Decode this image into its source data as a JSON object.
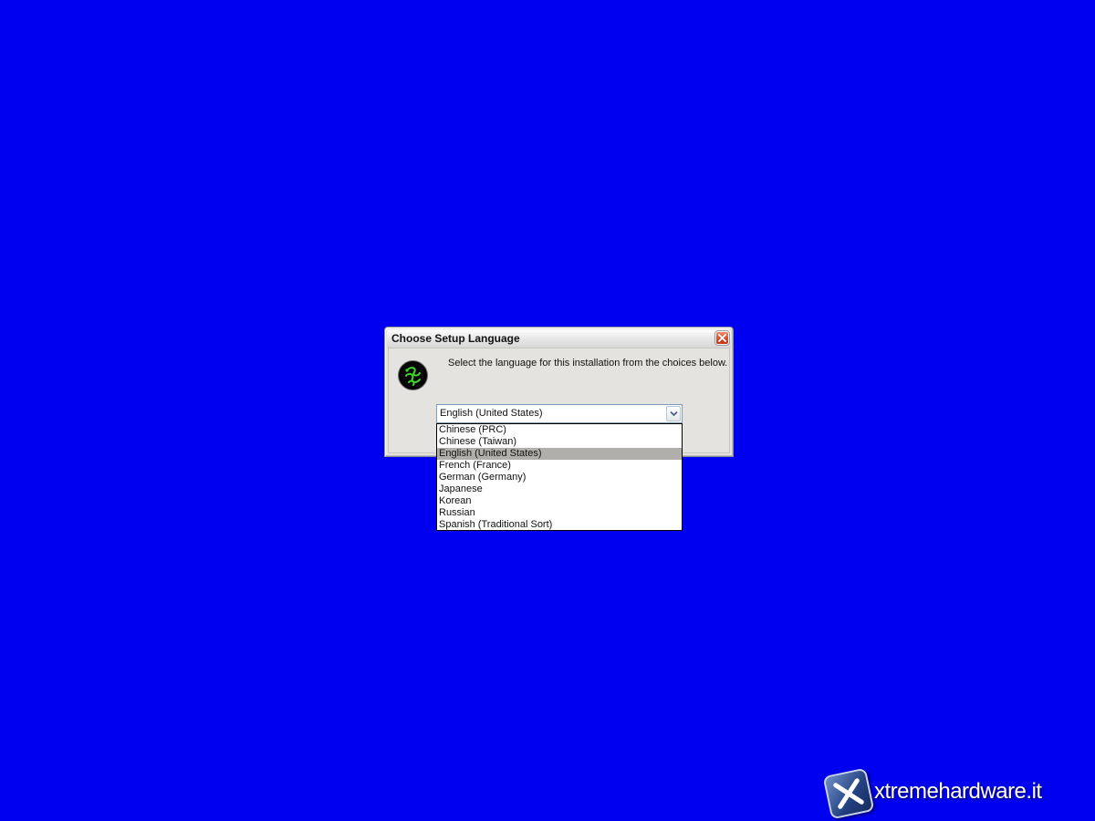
{
  "dialog": {
    "title": "Choose Setup Language",
    "prompt": "Select the language for this installation from the choices below.",
    "close_icon": "close-x-icon",
    "logo_icon": "razer-snake-logo-icon"
  },
  "language_select": {
    "selected_value": "English (United States)",
    "arrow_icon": "chevron-down-icon",
    "options": [
      "Chinese (PRC)",
      "Chinese (Taiwan)",
      "English (United States)",
      "French (France)",
      "German (Germany)",
      "Japanese",
      "Korean",
      "Russian",
      "Spanish (Traditional Sort)"
    ],
    "highlighted_option": "English (United States)"
  },
  "watermark": {
    "text": "xtremehardware.it"
  },
  "colors": {
    "desktop_background": "#0000F0",
    "dialog_background": "#E4E3DF",
    "close_button": "#D8482A",
    "logo_green": "#44D62C",
    "highlight": "#B0AFAC"
  }
}
